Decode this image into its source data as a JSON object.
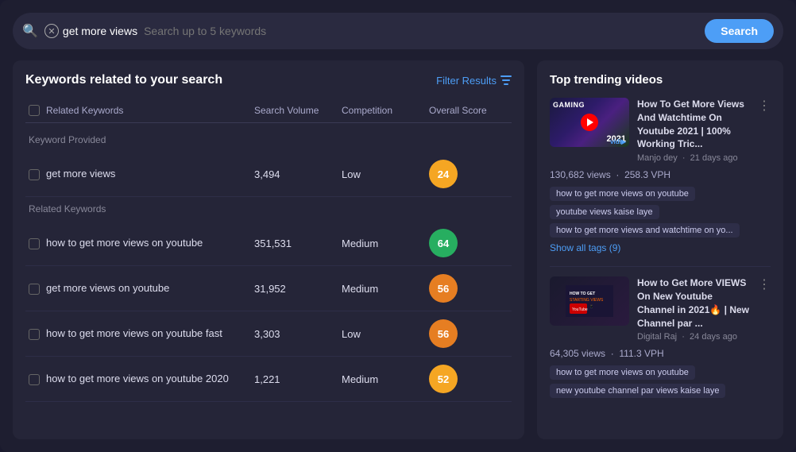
{
  "search": {
    "tag": "get more views",
    "placeholder": "Search up to 5 keywords",
    "button_label": "Search"
  },
  "left_panel": {
    "title": "Keywords related to your search",
    "filter_label": "Filter Results",
    "table": {
      "columns": [
        "Related Keywords",
        "Search Volume",
        "Competition",
        "Overall Score"
      ],
      "section_keyword_provided": "Keyword Provided",
      "section_related": "Related Keywords",
      "provided_rows": [
        {
          "keyword": "get more views",
          "volume": "3,494",
          "competition": "Low",
          "score": 24,
          "score_color": "orange"
        }
      ],
      "related_rows": [
        {
          "keyword": "how to get more views on youtube",
          "volume": "351,531",
          "competition": "Medium",
          "score": 64,
          "score_color": "green"
        },
        {
          "keyword": "get more views on youtube",
          "volume": "31,952",
          "competition": "Medium",
          "score": 56,
          "score_color": "yellow"
        },
        {
          "keyword": "how to get more views on youtube fast",
          "volume": "3,303",
          "competition": "Low",
          "score": 56,
          "score_color": "yellow"
        },
        {
          "keyword": "how to get more views on youtube 2020",
          "volume": "1,221",
          "competition": "Medium",
          "score": 52,
          "score_color": "orange"
        }
      ]
    }
  },
  "right_panel": {
    "title": "Top trending videos",
    "videos": [
      {
        "title": "How To Get More Views And Watchtime On Youtube 2021 | 100% Working Tric...",
        "channel": "Manjo dey",
        "time_ago": "21 days ago",
        "views": "130,682 views",
        "vph": "258.3 VPH",
        "thumb_type": "gaming",
        "tags": [
          "how to get more views on youtube",
          "youtube views kaise laye",
          "how to get more views and watchtime on yo..."
        ],
        "show_tags_label": "Show all tags (9)"
      },
      {
        "title": "How to Get More VIEWS On New Youtube Channel in 2021🔥 | New Channel par ...",
        "channel": "Digital Raj",
        "time_ago": "24 days ago",
        "views": "64,305 views",
        "vph": "111.3 VPH",
        "thumb_type": "channel",
        "tags": [
          "how to get more views on youtube",
          "new youtube channel par views kaise laye"
        ],
        "show_tags_label": null
      }
    ]
  }
}
